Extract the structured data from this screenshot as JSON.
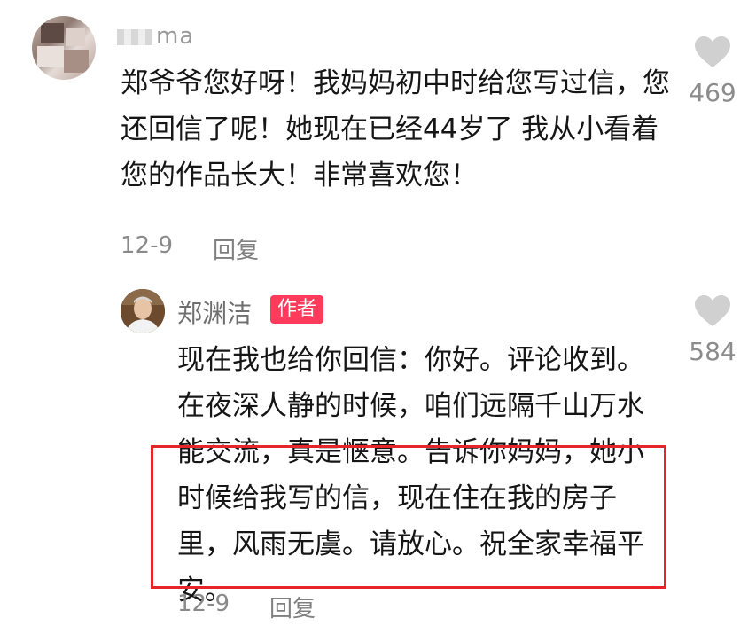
{
  "comment": {
    "username_visible": "ma",
    "text": "郑爷爷您好呀！我妈妈初中时给您写过信，您还回信了呢！她现在已经44岁了 我从小看着您的作品长大！非常喜欢您！",
    "date": "12-9",
    "reply_label": "回复",
    "likes": "469"
  },
  "reply": {
    "username": "郑渊洁",
    "badge": "作者",
    "text": "现在我也给你回信：你好。评论收到。在夜深人静的时候，咱们远隔千山万水能交流，真是惬意。告诉你妈妈，她小时候给我写的信，现在住在我的房子里，风雨无虞。请放心。祝全家幸福平安。",
    "date": "12-9",
    "reply_label": "回复",
    "likes": "584"
  },
  "colors": {
    "badge_bg": "#ff3b5c",
    "highlight_box": "#e8242b",
    "heart": "#d0d0d0"
  },
  "icons": {
    "like": "heart-icon"
  }
}
